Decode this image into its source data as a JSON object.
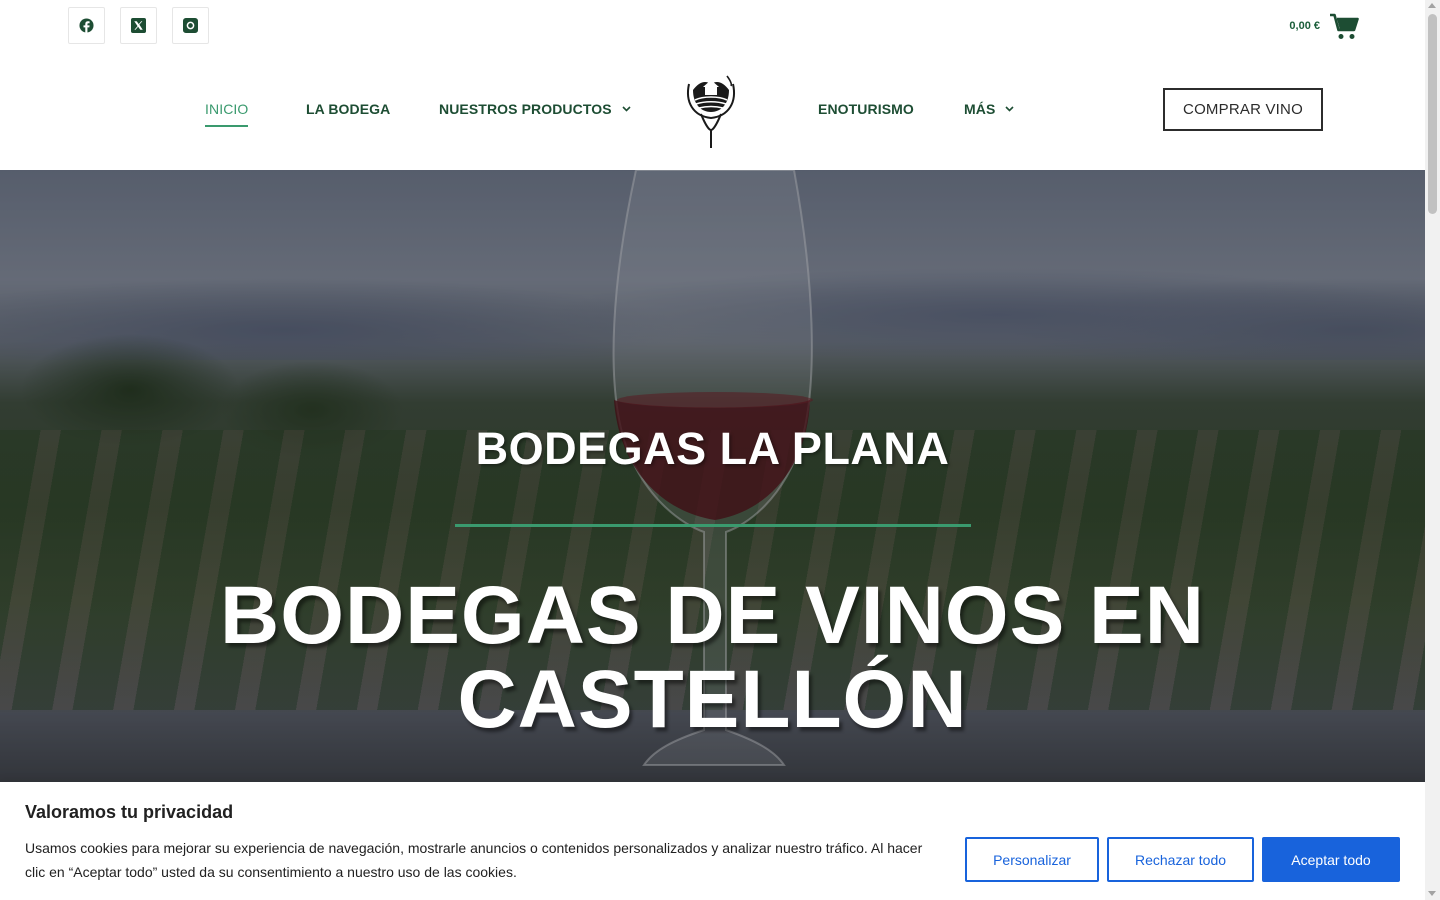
{
  "topbar": {
    "social": [
      "facebook-icon",
      "x-twitter-icon",
      "instagram-icon"
    ],
    "cart_amount": "0,00 €"
  },
  "nav": {
    "items": [
      {
        "label": "INICIO"
      },
      {
        "label": "LA BODEGA"
      },
      {
        "label": "NUESTROS PRODUCTOS"
      },
      {
        "label": "ENOTURISMO"
      },
      {
        "label": "MÁS"
      }
    ],
    "buy_button": "COMPRAR VINO"
  },
  "hero": {
    "subtitle": "BODEGAS LA PLANA",
    "title_line1": "BODEGAS DE VINOS EN",
    "title_line2": "CASTELLÓN"
  },
  "cookie": {
    "title": "Valoramos tu privacidad",
    "text": "Usamos cookies para mejorar su experiencia de navegación, mostrarle anuncios o contenidos personalizados y analizar nuestro tráfico. Al hacer clic en “Aceptar todo” usted da su consentimiento a nuestro uso de las cookies.",
    "customize": "Personalizar",
    "reject": "Rechazar todo",
    "accept": "Aceptar todo"
  },
  "colors": {
    "brand_green": "#1d4d33",
    "accent_green": "#3a9a6e",
    "cookie_blue": "#1863dc"
  }
}
